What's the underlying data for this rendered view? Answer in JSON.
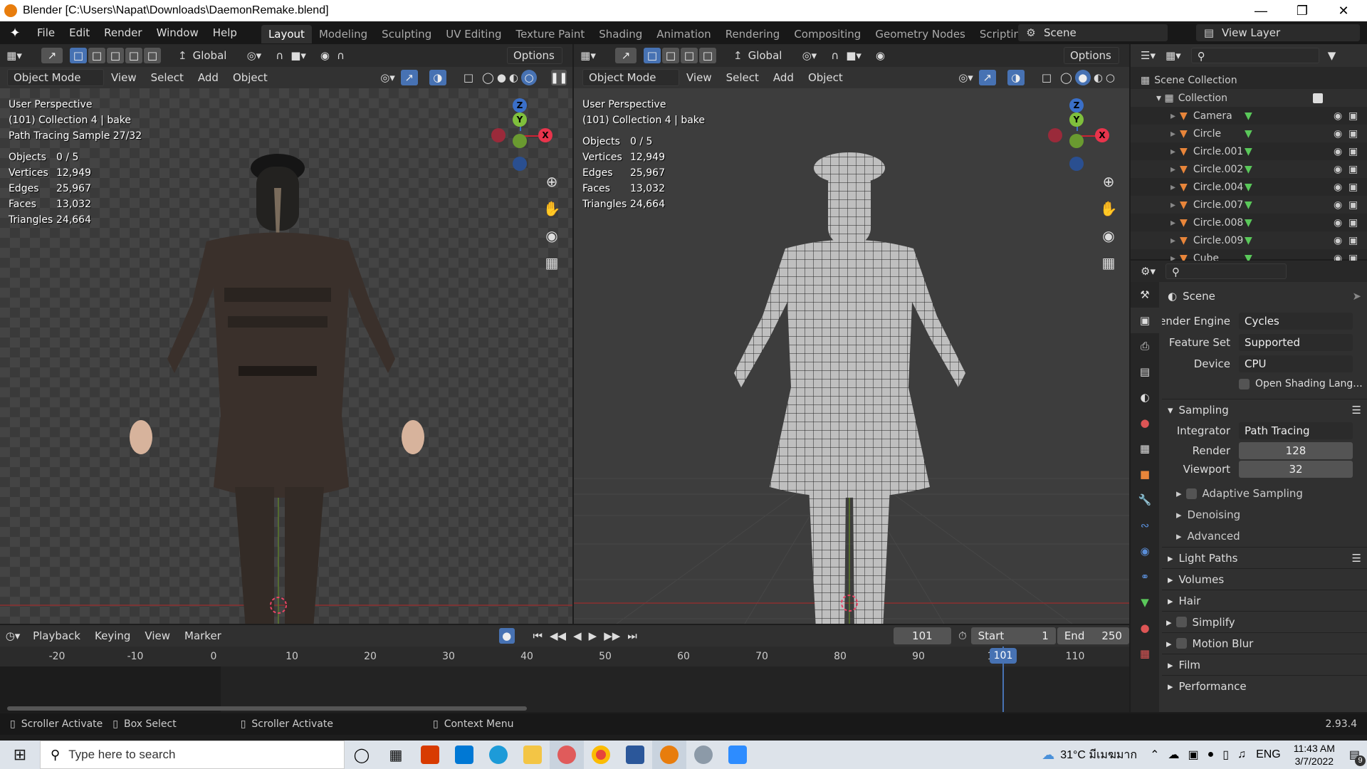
{
  "window": {
    "title": "Blender [C:\\Users\\Napat\\Downloads\\DaemonRemake.blend]"
  },
  "menu": [
    "File",
    "Edit",
    "Render",
    "Window",
    "Help"
  ],
  "workspaces": [
    "Layout",
    "Modeling",
    "Sculpting",
    "UV Editing",
    "Texture Paint",
    "Shading",
    "Animation",
    "Rendering",
    "Compositing",
    "Geometry Nodes",
    "Scripting"
  ],
  "active_workspace": "Layout",
  "scene_name": "Scene",
  "view_layer": "View Layer",
  "toolbar": {
    "orientation": "Global",
    "options": "Options",
    "mode": "Object Mode",
    "view": "View",
    "select": "Select",
    "add": "Add",
    "object": "Object"
  },
  "viewport_left": {
    "perspective": "User Perspective",
    "collection": "(101) Collection 4 | bake",
    "sample": "Path Tracing Sample 27/32",
    "stats": [
      {
        "label": "Objects",
        "value": "0 / 5"
      },
      {
        "label": "Vertices",
        "value": "12,949"
      },
      {
        "label": "Edges",
        "value": "25,967"
      },
      {
        "label": "Faces",
        "value": "13,032"
      },
      {
        "label": "Triangles",
        "value": "24,664"
      }
    ]
  },
  "viewport_right": {
    "perspective": "User Perspective",
    "collection": "(101) Collection 4 | bake",
    "stats": [
      {
        "label": "Objects",
        "value": "0 / 5"
      },
      {
        "label": "Vertices",
        "value": "12,949"
      },
      {
        "label": "Edges",
        "value": "25,967"
      },
      {
        "label": "Faces",
        "value": "13,032"
      },
      {
        "label": "Triangles",
        "value": "24,664"
      }
    ]
  },
  "gizmo": {
    "z": "Z",
    "y": "Y",
    "x": "X"
  },
  "outliner": {
    "root": "Scene Collection",
    "collection": "Collection",
    "items": [
      "Camera",
      "Circle",
      "Circle.001",
      "Circle.002",
      "Circle.004",
      "Circle.007",
      "Circle.008",
      "Circle.009",
      "Cube"
    ]
  },
  "properties": {
    "context": "Scene",
    "render_engine_label": "Render Engine",
    "render_engine": "Cycles",
    "feature_set_label": "Feature Set",
    "feature_set": "Supported",
    "device_label": "Device",
    "device": "CPU",
    "osl_label": "Open Shading Lang...",
    "sampling": "Sampling",
    "integrator_label": "Integrator",
    "integrator": "Path Tracing",
    "render_label": "Render",
    "render_samples": "128",
    "viewport_label": "Viewport",
    "viewport_samples": "32",
    "subpanels": [
      "Adaptive Sampling",
      "Denoising",
      "Advanced"
    ],
    "panels": [
      "Light Paths",
      "Volumes",
      "Hair",
      "Simplify",
      "Motion Blur",
      "Film",
      "Performance"
    ]
  },
  "timeline": {
    "menus": [
      "Playback",
      "Keying",
      "View",
      "Marker"
    ],
    "current_frame": "101",
    "start_label": "Start",
    "start": "1",
    "end_label": "End",
    "end": "250",
    "ticks": [
      "-20",
      "-10",
      "0",
      "10",
      "20",
      "30",
      "40",
      "50",
      "60",
      "70",
      "80",
      "90",
      "100",
      "110"
    ],
    "playhead": "101"
  },
  "statusbar": {
    "items": [
      "Scroller Activate",
      "Box Select",
      "Scroller Activate",
      "Context Menu"
    ],
    "version": "2.93.4"
  },
  "taskbar": {
    "search_placeholder": "Type here to search",
    "weather": "31°C มีเมฆมาก",
    "language": "ENG",
    "time": "11:43 AM",
    "date": "3/7/2022",
    "notifications": "9"
  }
}
